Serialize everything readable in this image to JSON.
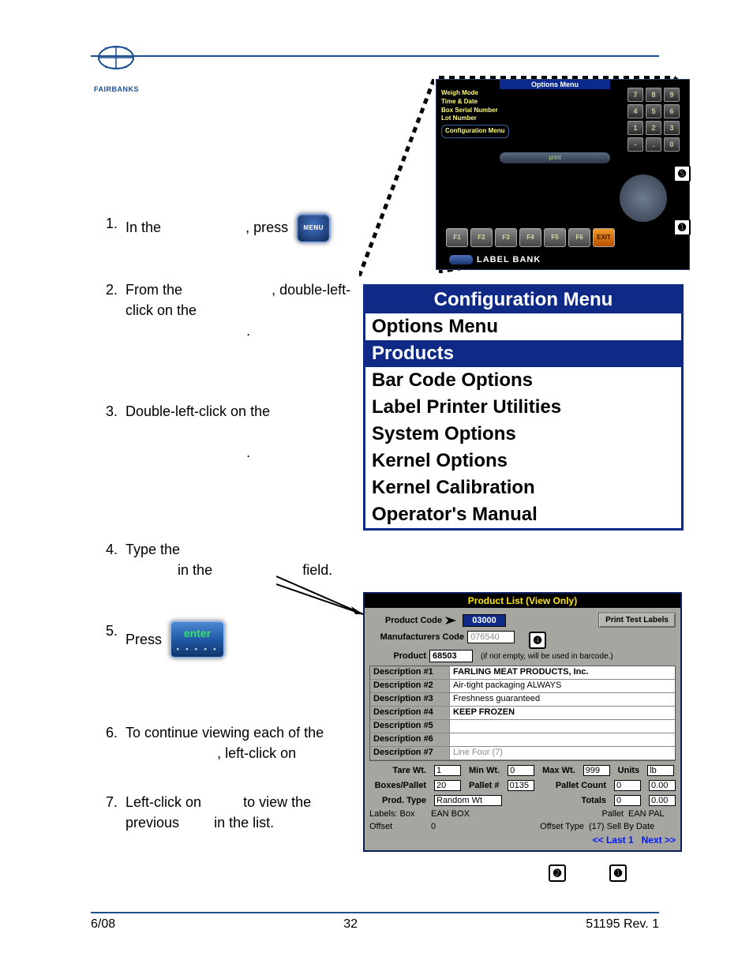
{
  "logo_text": "FAIRBANKS",
  "steps": [
    {
      "pre": "In the ",
      "post": ", press"
    },
    {
      "pre": "From the ",
      "mid": ", double-left-click on the ",
      "end": "."
    },
    {
      "pre": "Double-left-click on the ",
      "end": "."
    },
    {
      "pre": "Type the ",
      "mid": " in the ",
      "post": " field."
    },
    {
      "pre": "Press "
    },
    {
      "pre": "To continue viewing each of the ",
      "mid": ", left-click on "
    },
    {
      "pre": "Left-click on ",
      "mid": " to view the previous ",
      "post": " in the list."
    }
  ],
  "menu_btn_label": "MENU",
  "enter_btn_label": "enter",
  "terminal": {
    "title": "Options Menu",
    "items": [
      "Weigh Mode",
      "Time & Date",
      "Box Serial Number",
      "Lot Number"
    ],
    "conf_item": "Configuration Menu",
    "keypad": [
      "7",
      "8",
      "9",
      "4",
      "5",
      "6",
      "1",
      "2",
      "3",
      "-",
      ".",
      "0"
    ],
    "print_label": "print",
    "fkeys": [
      "F1",
      "F2",
      "F3",
      "F4",
      "F5",
      "F6"
    ],
    "exit_label": "EXIT",
    "brand": "LABEL    BANK"
  },
  "markers": {
    "one": "➊",
    "two": "➋",
    "four": "➍",
    "five": "➎"
  },
  "conf_menu": {
    "title": "Configuration Menu",
    "subtitle": "Options Menu",
    "selected": "Products",
    "items": [
      "Bar Code Options",
      "Label Printer Utilities",
      "System Options",
      "Kernel Options",
      "Kernel Calibration",
      "Operator's Manual"
    ]
  },
  "product": {
    "title": "Product List (View Only)",
    "labels": {
      "product_code": "Product Code",
      "manu_code": "Manufacturers Code",
      "product": "Product",
      "product_note": "(if not empty, will be used in barcode.)",
      "print_test": "Print Test Labels",
      "desc_prefix": "Description #",
      "tare": "Tare Wt.",
      "minwt": "Min Wt.",
      "maxwt": "Max Wt.",
      "units": "Units",
      "boxes": "Boxes/Pallet",
      "palletno": "Pallet #",
      "palletcount": "Pallet Count",
      "totals": "Totals",
      "prodtype": "Prod. Type",
      "labelsbox": "Labels: Box",
      "pallet": "Pallet",
      "offset": "Offset",
      "offsettype": "Offset Type",
      "last": "<< Last 1",
      "next": "Next >>"
    },
    "values": {
      "product_code": "03000",
      "manu_code": "076540",
      "product": "68503",
      "desc": [
        "FARLING MEAT PRODUCTS, Inc.",
        "Air-tight packaging ALWAYS",
        "Freshness guaranteed",
        "KEEP FROZEN",
        "",
        "",
        "Line Four (7)"
      ],
      "tare": "1",
      "minwt": "0",
      "maxwt": "999",
      "units": "lb",
      "boxes": "20",
      "palletno": "0135",
      "palletcount": "0",
      "palletcount_dec": "0.00",
      "totals": "0",
      "totals_dec": "0.00",
      "prodtype": "Random Wt",
      "labelsbox": "EAN BOX",
      "pallet": "EAN PAL",
      "offset": "0",
      "offsettype": "(17) Sell By Date"
    }
  },
  "footer": {
    "left": "6/08",
    "center": "32",
    "right": "51195    Rev. 1"
  }
}
